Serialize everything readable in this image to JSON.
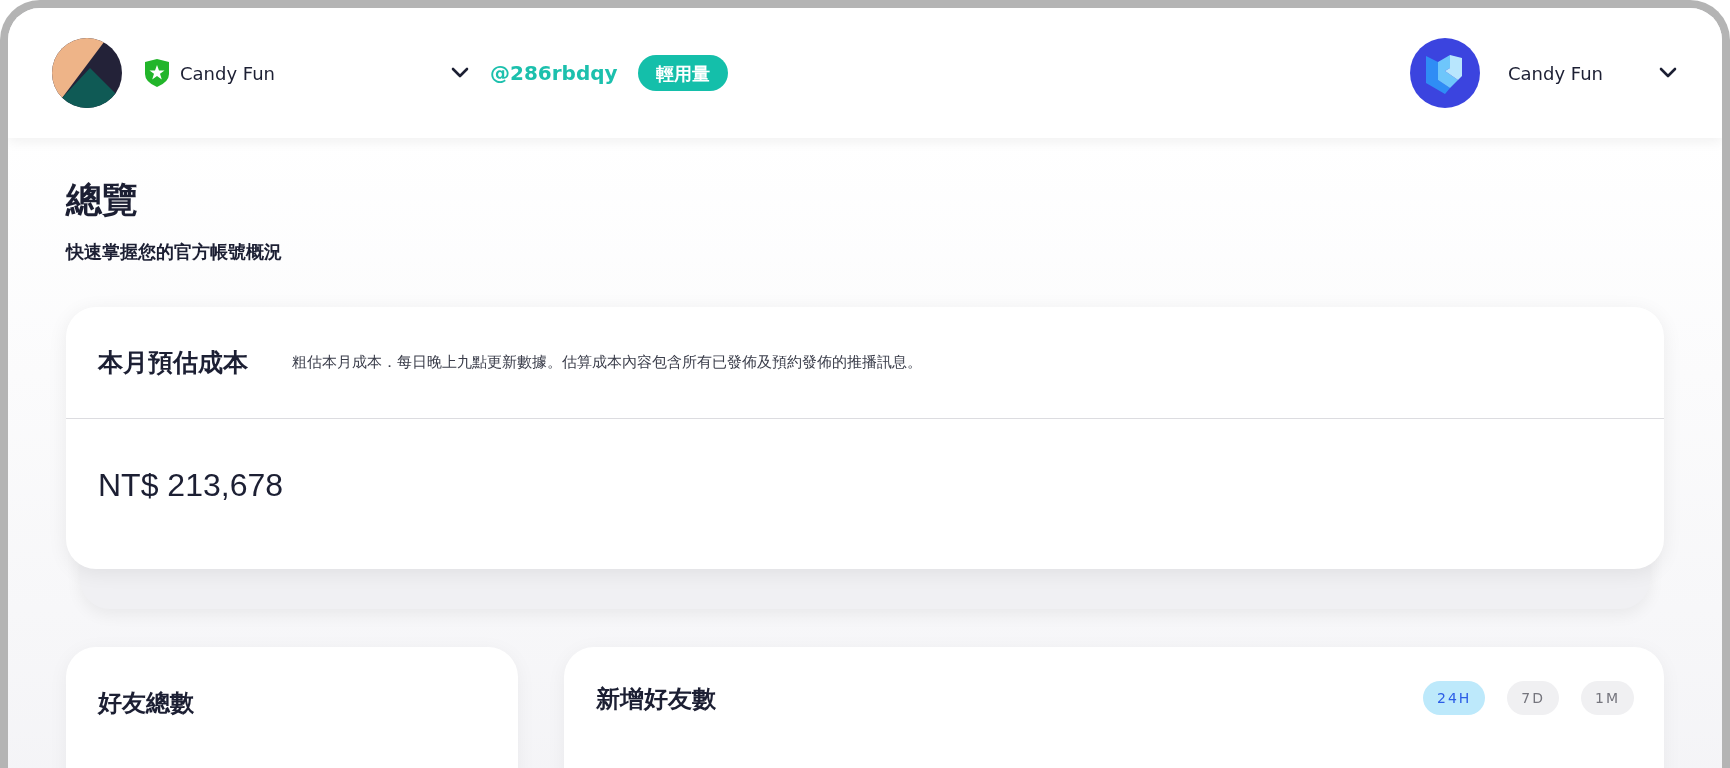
{
  "header": {
    "account_name": "Candy Fun",
    "account_id": "@286rbdqy",
    "plan_badge": "輕用量",
    "user_name": "Candy Fun"
  },
  "page": {
    "title": "總覽",
    "subtitle": "快速掌握您的官方帳號概況"
  },
  "cost_card": {
    "title": "本月預估成本",
    "description": "粗估本月成本．每日晚上九點更新數據。估算成本內容包含所有已發佈及預約發佈的推播訊息。",
    "amount": "NT$ 213,678"
  },
  "friends_card": {
    "title": "好友總數"
  },
  "new_friends_card": {
    "title": "新增好友數",
    "ranges": [
      {
        "label": "24H",
        "selected": true
      },
      {
        "label": "7D",
        "selected": false
      },
      {
        "label": "1M",
        "selected": false
      }
    ]
  }
}
